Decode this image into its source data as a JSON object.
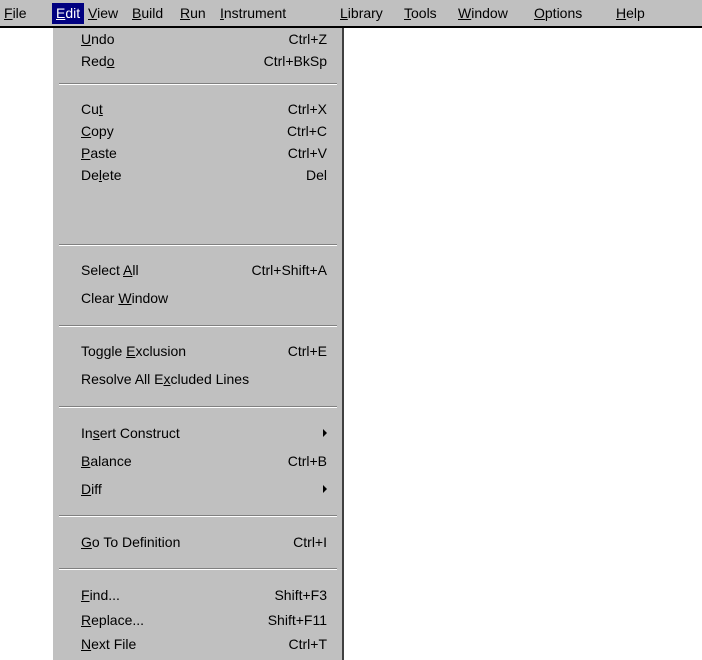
{
  "menubar": {
    "items": [
      {
        "pre": "",
        "key": "F",
        "post": "ile"
      },
      {
        "pre": "",
        "key": "E",
        "post": "dit"
      },
      {
        "pre": "",
        "key": "V",
        "post": "iew"
      },
      {
        "pre": "",
        "key": "B",
        "post": "uild"
      },
      {
        "pre": "",
        "key": "R",
        "post": "un"
      },
      {
        "pre": "",
        "key": "I",
        "post": "nstrument"
      },
      {
        "pre": "",
        "key": "L",
        "post": "ibrary"
      },
      {
        "pre": "",
        "key": "T",
        "post": "ools"
      },
      {
        "pre": "",
        "key": "W",
        "post": "indow"
      },
      {
        "pre": "",
        "key": "O",
        "post": "ptions"
      },
      {
        "pre": "",
        "key": "H",
        "post": "elp"
      }
    ]
  },
  "edit_menu": {
    "items": [
      {
        "pre": "",
        "key": "U",
        "post": "ndo",
        "shortcut": "Ctrl+Z"
      },
      {
        "pre": "Red",
        "key": "o",
        "post": "",
        "shortcut": "Ctrl+BkSp"
      },
      {
        "pre": "Cu",
        "key": "t",
        "post": "",
        "shortcut": "Ctrl+X"
      },
      {
        "pre": "",
        "key": "C",
        "post": "opy",
        "shortcut": "Ctrl+C"
      },
      {
        "pre": "",
        "key": "P",
        "post": "aste",
        "shortcut": "Ctrl+V"
      },
      {
        "pre": "De",
        "key": "l",
        "post": "ete",
        "shortcut": "Del"
      },
      {
        "pre": "Select ",
        "key": "A",
        "post": "ll",
        "shortcut": "Ctrl+Shift+A"
      },
      {
        "pre": "Clear ",
        "key": "W",
        "post": "indow",
        "shortcut": ""
      },
      {
        "pre": "Toggle ",
        "key": "E",
        "post": "xclusion",
        "shortcut": "Ctrl+E"
      },
      {
        "pre": "Resolve All E",
        "key": "x",
        "post": "cluded Lines",
        "shortcut": ""
      },
      {
        "pre": "In",
        "key": "s",
        "post": "ert Construct",
        "shortcut": ""
      },
      {
        "pre": "",
        "key": "B",
        "post": "alance",
        "shortcut": "Ctrl+B"
      },
      {
        "pre": "",
        "key": "D",
        "post": "iff",
        "shortcut": ""
      },
      {
        "pre": "",
        "key": "G",
        "post": "o To Definition",
        "shortcut": "Ctrl+I"
      },
      {
        "pre": "",
        "key": "F",
        "post": "ind...",
        "shortcut": "Shift+F3"
      },
      {
        "pre": "",
        "key": "R",
        "post": "eplace...",
        "shortcut": "Shift+F11"
      },
      {
        "pre": "",
        "key": "N",
        "post": "ext File",
        "shortcut": "Ctrl+T"
      }
    ]
  }
}
